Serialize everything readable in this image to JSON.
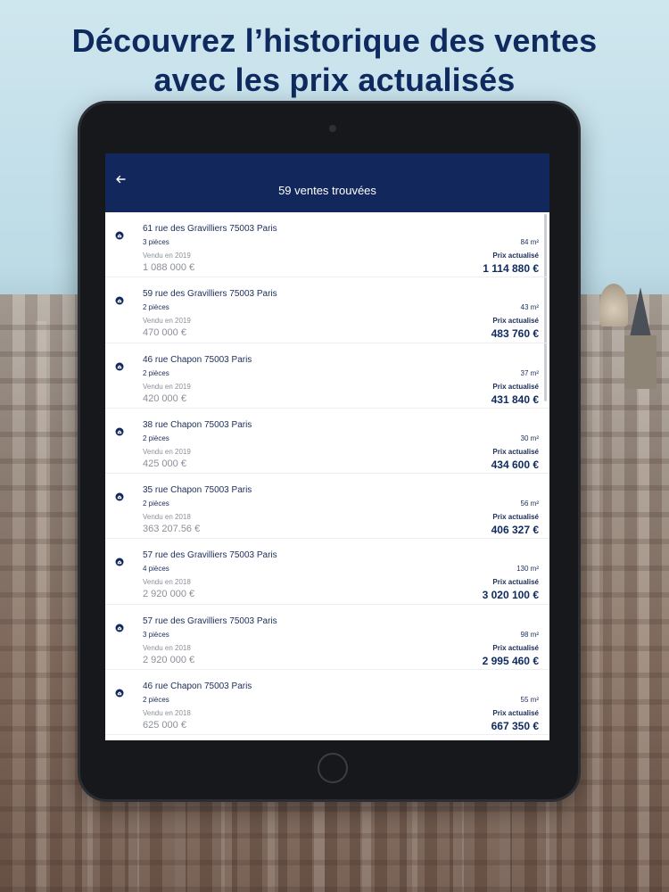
{
  "headline": {
    "line1": "Découvrez l’historique des ventes",
    "line2": "avec les prix actualisés"
  },
  "appbar": {
    "back_icon": "arrow-left-icon",
    "title": "59 ventes trouvées"
  },
  "sales": [
    {
      "address": "61 rue des Gravilliers 75003 Paris",
      "rooms": "3 pièces",
      "area": "84 m²",
      "sold": "Vendu en 2019",
      "updated_label": "Prix actualisé",
      "price_sold": "1 088 000 €",
      "price_updated": "1 114 880 €"
    },
    {
      "address": "59 rue des Gravilliers 75003 Paris",
      "rooms": "2 pièces",
      "area": "43 m²",
      "sold": "Vendu en 2019",
      "updated_label": "Prix actualisé",
      "price_sold": "470 000 €",
      "price_updated": "483 760 €"
    },
    {
      "address": "46 rue Chapon 75003 Paris",
      "rooms": "2 pièces",
      "area": "37 m²",
      "sold": "Vendu en 2019",
      "updated_label": "Prix actualisé",
      "price_sold": "420 000 €",
      "price_updated": "431 840 €"
    },
    {
      "address": "38 rue Chapon 75003 Paris",
      "rooms": "2 pièces",
      "area": "30 m²",
      "sold": "Vendu en 2019",
      "updated_label": "Prix actualisé",
      "price_sold": "425 000 €",
      "price_updated": "434 600 €"
    },
    {
      "address": "35 rue Chapon 75003 Paris",
      "rooms": "2 pièces",
      "area": "56 m²",
      "sold": "Vendu en 2018",
      "updated_label": "Prix actualisé",
      "price_sold": "363 207.56 €",
      "price_updated": "406 327 €"
    },
    {
      "address": "57 rue des Gravilliers 75003 Paris",
      "rooms": "4 pièces",
      "area": "130 m²",
      "sold": "Vendu en 2018",
      "updated_label": "Prix actualisé",
      "price_sold": "2 920 000 €",
      "price_updated": "3 020 100 €"
    },
    {
      "address": "57 rue des Gravilliers 75003 Paris",
      "rooms": "3 pièces",
      "area": "98 m²",
      "sold": "Vendu en 2018",
      "updated_label": "Prix actualisé",
      "price_sold": "2 920 000 €",
      "price_updated": "2 995 460 €"
    },
    {
      "address": "46 rue Chapon 75003 Paris",
      "rooms": "2 pièces",
      "area": "55 m²",
      "sold": "Vendu en 2018",
      "updated_label": "Prix actualisé",
      "price_sold": "625 000 €",
      "price_updated": "667 350 €"
    }
  ],
  "colors": {
    "brand_navy": "#12275b",
    "headline": "#0f2a5f",
    "muted": "#8b8f98"
  }
}
